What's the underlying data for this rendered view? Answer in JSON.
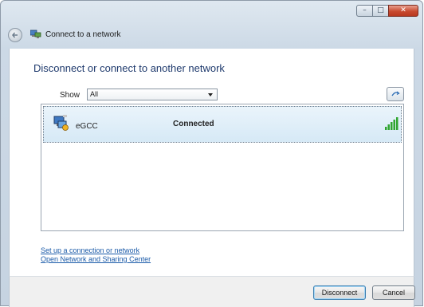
{
  "window": {
    "title": "Connect to a network",
    "controls": {
      "minimize": "–",
      "maximize": "□",
      "close": "✕"
    }
  },
  "main": {
    "heading": "Disconnect or connect to another network",
    "show": {
      "label": "Show",
      "selected": "All"
    }
  },
  "networks": [
    {
      "name": "eGCC",
      "status": "Connected",
      "signal_bars": 5
    }
  ],
  "links": {
    "setup": "Set up a connection or network",
    "sharing_center": "Open Network and Sharing Center"
  },
  "buttons": {
    "disconnect": "Disconnect",
    "cancel": "Cancel"
  },
  "colors": {
    "heading": "#1f3a6d",
    "link": "#1a5aa8",
    "signal": "#2fa52f",
    "selected_row": "#d6e9f6"
  }
}
